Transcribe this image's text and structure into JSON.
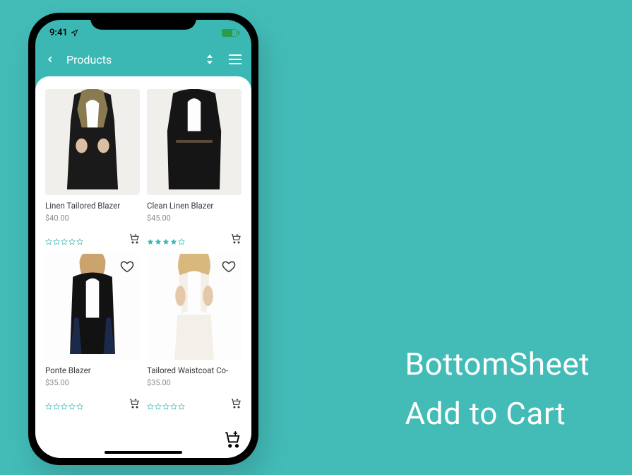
{
  "pageTitle": {
    "line1": "BottomSheet",
    "line2": "Add to Cart"
  },
  "statusBar": {
    "time": "9:41"
  },
  "header": {
    "title": "Products"
  },
  "colors": {
    "accent": "#3cb8b4",
    "bg": "#43bcb8"
  },
  "products": [
    {
      "name": "Linen Tailored Blazer",
      "price": "$40.00",
      "rating": 0,
      "showFavorite": false
    },
    {
      "name": "Clean Linen Blazer",
      "price": "$45.00",
      "rating": 4,
      "showFavorite": false
    },
    {
      "name": "Ponte Blazer",
      "price": "$35.00",
      "rating": 0,
      "showFavorite": true
    },
    {
      "name": "Tailored Waistcoat Co-",
      "price": "$35.00",
      "rating": 0,
      "showFavorite": true
    }
  ]
}
